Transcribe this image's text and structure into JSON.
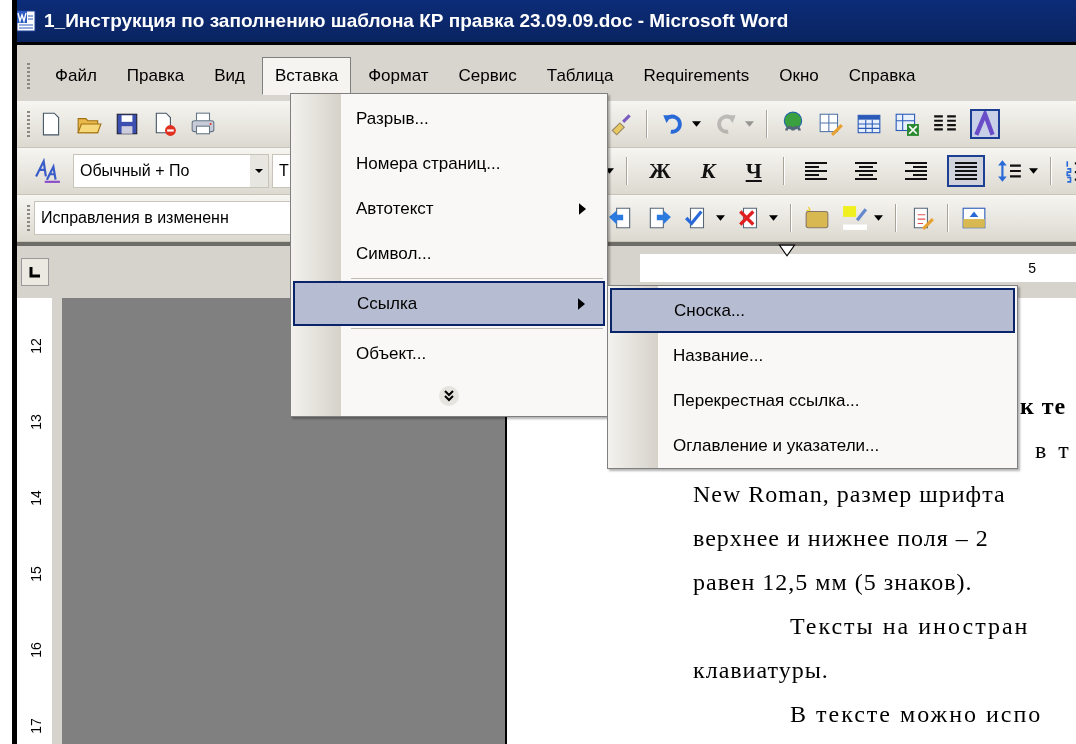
{
  "window": {
    "title": "1_Инструкция по заполнению шаблона КР правка 23.09.09.doc - Microsoft Word"
  },
  "menu_bar": [
    {
      "label": "Файл",
      "selected": false
    },
    {
      "label": "Правка",
      "selected": false
    },
    {
      "label": "Вид",
      "selected": false
    },
    {
      "label": "Вставка",
      "selected": true
    },
    {
      "label": "Формат",
      "selected": false
    },
    {
      "label": "Сервис",
      "selected": false
    },
    {
      "label": "Таблица",
      "selected": false
    },
    {
      "label": "Requirements",
      "selected": false
    },
    {
      "label": "Окно",
      "selected": false
    },
    {
      "label": "Справка",
      "selected": false
    }
  ],
  "standard_toolbar": {
    "undo": {
      "disabled": false
    },
    "redo": {
      "disabled": true
    }
  },
  "formatting_toolbar": {
    "style": "Обычный + По",
    "font": "Т",
    "text_buttons": [
      {
        "label": "Ж",
        "kind": "bold"
      },
      {
        "label": "К",
        "kind": "italic"
      },
      {
        "label": "Ч",
        "kind": "underline"
      }
    ],
    "alignment": [
      {
        "kind": "left",
        "selected": false
      },
      {
        "kind": "center",
        "selected": false
      },
      {
        "kind": "right",
        "selected": false
      },
      {
        "kind": "justify",
        "selected": true
      }
    ]
  },
  "reviewing_toolbar": {
    "display_mode": "Исправления в измененн"
  },
  "horizontal_ruler": {
    "labels": [
      "5"
    ]
  },
  "vertical_ruler": {
    "labels": [
      "12",
      "13",
      "14",
      "15",
      "16",
      "17"
    ]
  },
  "document": {
    "lines": [
      {
        "kind": "heading",
        "text": "к те"
      },
      {
        "kind": "fragment",
        "text": "в т"
      },
      {
        "kind": "line",
        "text": "New Roman, размер шрифта"
      },
      {
        "kind": "line",
        "text": "верхнее и нижнее поля – 2"
      },
      {
        "kind": "line",
        "text": "равен 12,5 мм (5 знаков)."
      },
      {
        "kind": "first_line",
        "text": "Тексты на иностран"
      },
      {
        "kind": "line",
        "text": "клавиатуры."
      },
      {
        "kind": "first_line",
        "text": "В тексте можно испо"
      }
    ]
  },
  "insert_menu": {
    "groups": [
      {
        "items": [
          {
            "label": "Разрыв...",
            "submenu": false,
            "selected": false
          },
          {
            "label": "Номера страниц...",
            "submenu": false,
            "selected": false
          },
          {
            "label": "Автотекст",
            "submenu": true,
            "selected": false
          },
          {
            "label": "Символ...",
            "submenu": false,
            "selected": false
          }
        ]
      },
      {
        "items": [
          {
            "label": "Ссылка",
            "submenu": true,
            "selected": true
          }
        ]
      },
      {
        "items": [
          {
            "label": "Объект...",
            "submenu": false,
            "selected": false
          }
        ]
      }
    ]
  },
  "reference_submenu": {
    "items": [
      {
        "label": "Сноска...",
        "selected": true
      },
      {
        "label": "Название...",
        "selected": false
      },
      {
        "label": "Перекрестная ссылка...",
        "selected": false
      },
      {
        "label": "Оглавление и указатели...",
        "selected": false
      }
    ]
  }
}
